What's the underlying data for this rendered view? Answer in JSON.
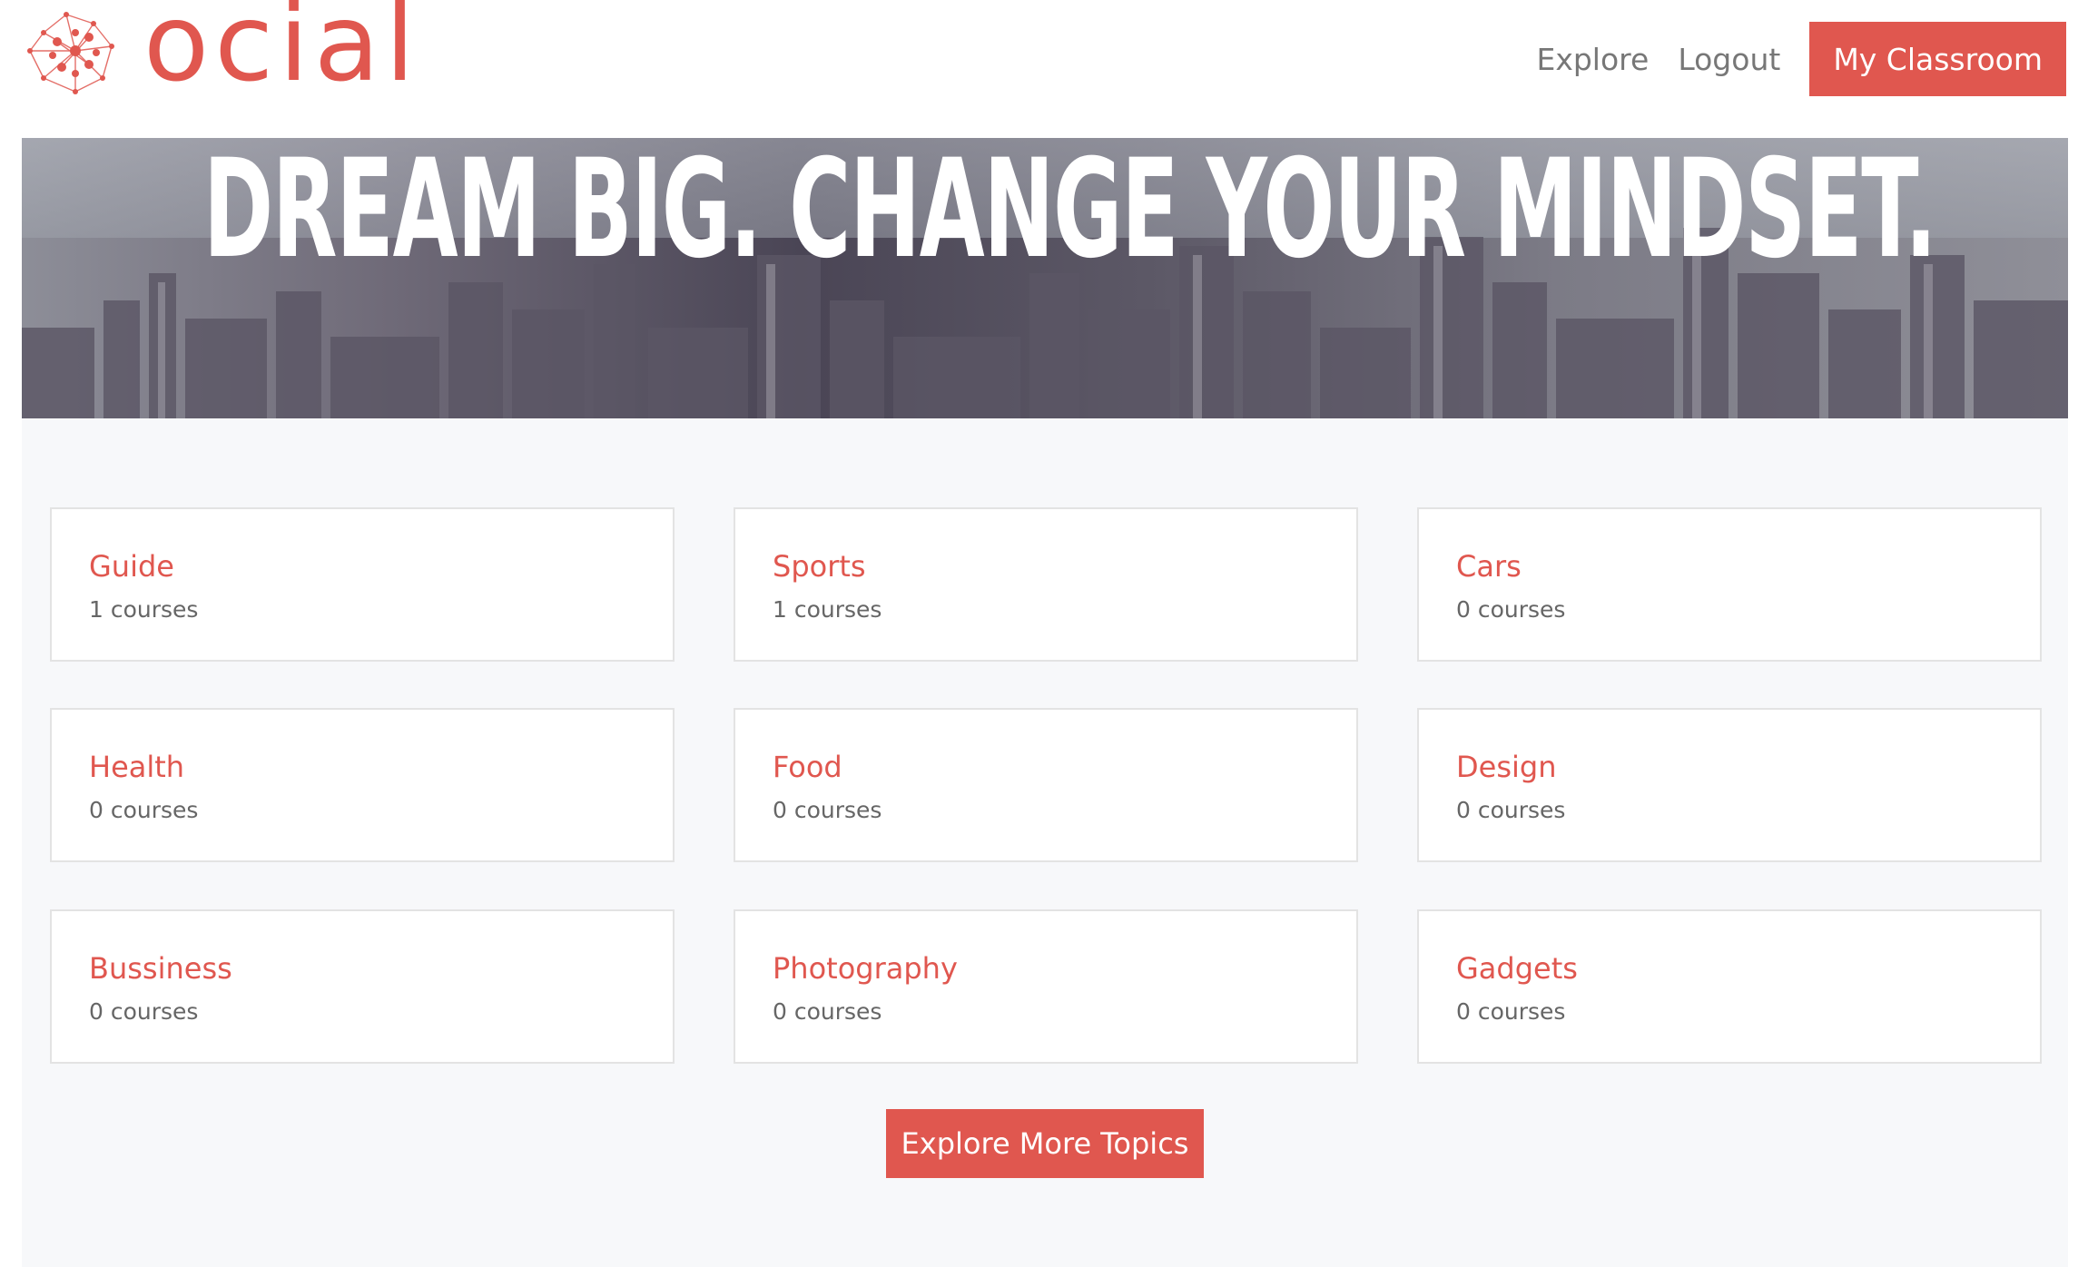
{
  "brand": {
    "logo_text": "ocial",
    "accent_color": "#e0574f",
    "logo_icon": "network-node-icon"
  },
  "nav": {
    "explore_label": "Explore",
    "logout_label": "Logout",
    "classroom_label": "My Classroom"
  },
  "hero": {
    "headline": "DREAM BIG. CHANGE YOUR MINDSET."
  },
  "topics": [
    {
      "name": "Guide",
      "count": "1 courses"
    },
    {
      "name": "Sports",
      "count": "1 courses"
    },
    {
      "name": "Cars",
      "count": "0 courses"
    },
    {
      "name": "Health",
      "count": "0 courses"
    },
    {
      "name": "Food",
      "count": "0 courses"
    },
    {
      "name": "Design",
      "count": "0 courses"
    },
    {
      "name": "Bussiness",
      "count": "0 courses"
    },
    {
      "name": "Photography",
      "count": "0 courses"
    },
    {
      "name": "Gadgets",
      "count": "0 courses"
    }
  ],
  "actions": {
    "explore_more_label": "Explore More Topics"
  }
}
